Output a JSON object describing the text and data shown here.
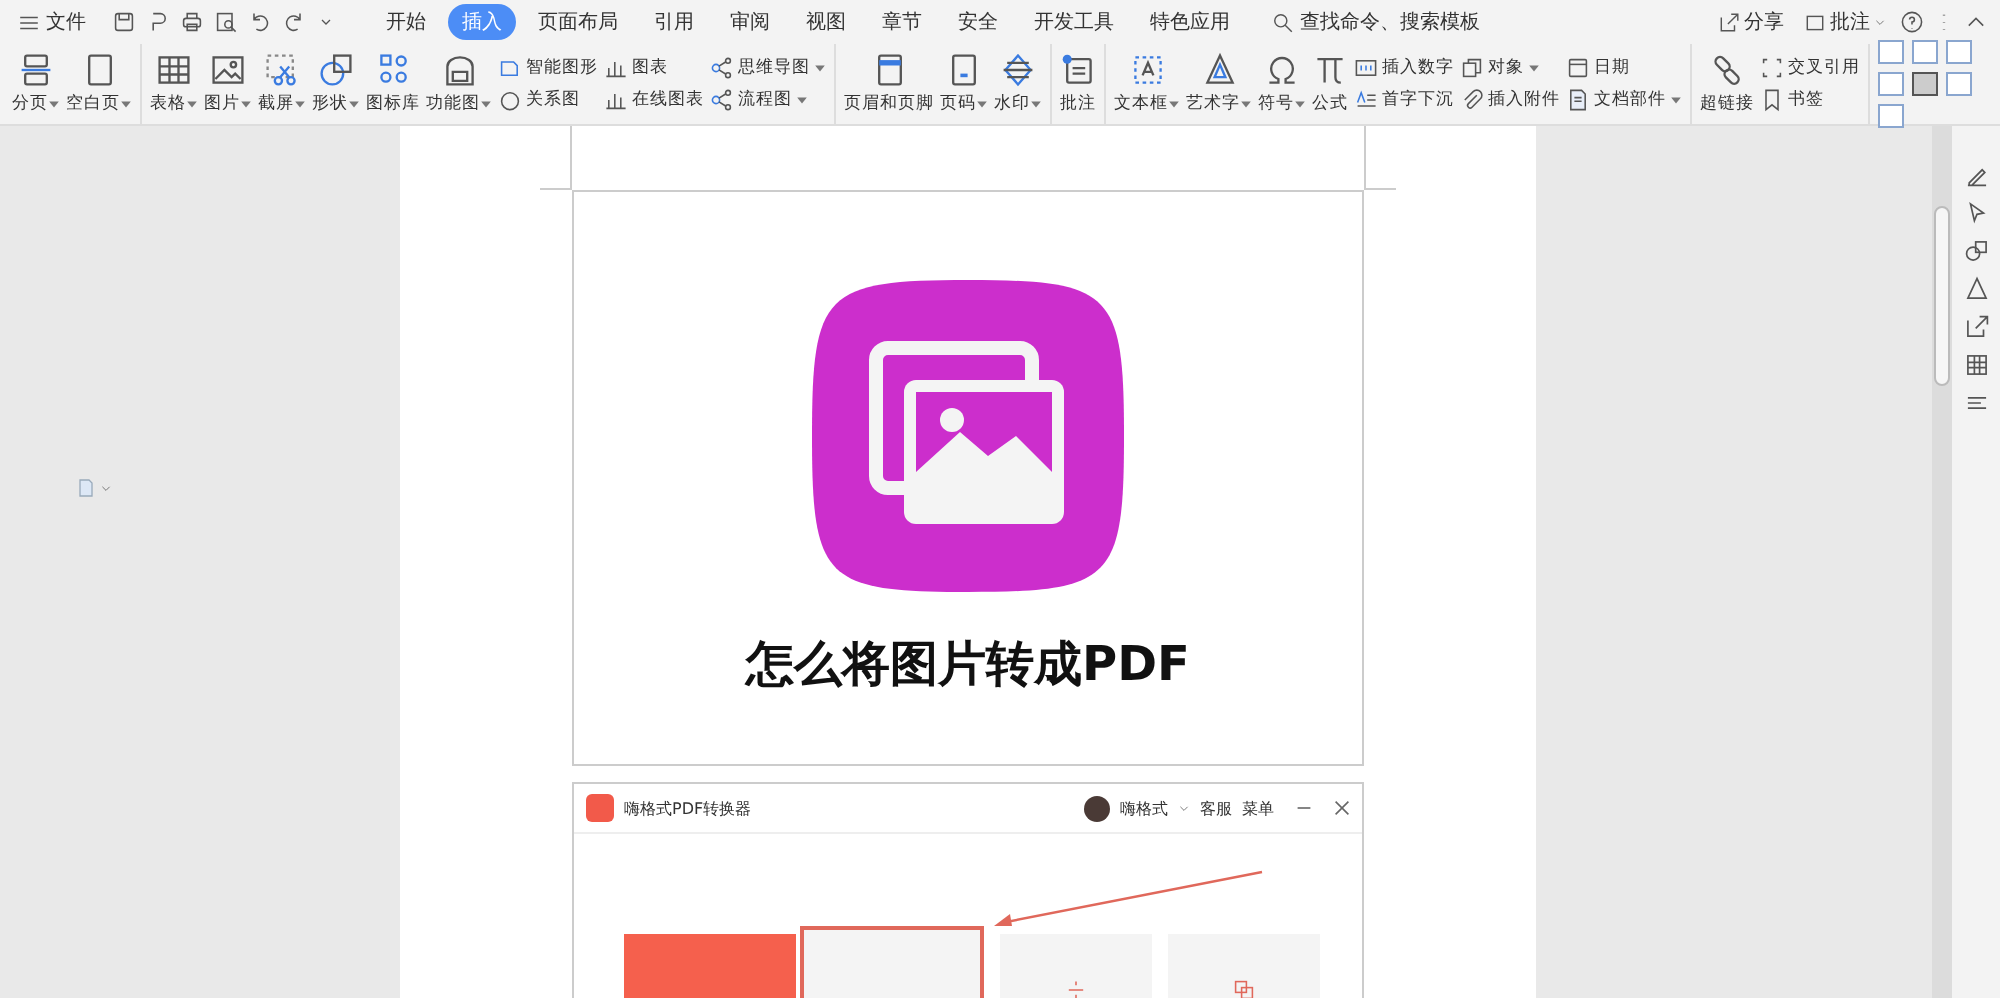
{
  "menubar": {
    "file_label": "文件",
    "tabs": [
      {
        "label": "开始",
        "selected": false
      },
      {
        "label": "插入",
        "selected": true
      },
      {
        "label": "页面布局",
        "selected": false
      },
      {
        "label": "引用",
        "selected": false
      },
      {
        "label": "审阅",
        "selected": false
      },
      {
        "label": "视图",
        "selected": false
      },
      {
        "label": "章节",
        "selected": false
      },
      {
        "label": "安全",
        "selected": false
      },
      {
        "label": "开发工具",
        "selected": false
      },
      {
        "label": "特色应用",
        "selected": false
      }
    ],
    "search": {
      "placeholder": "查找命令、搜索模板"
    },
    "share_label": "分享",
    "comment_label": "批注"
  },
  "ribbon": {
    "groups": [
      {
        "items": [
          {
            "kind": "large",
            "label": "分页",
            "dropdown": true
          },
          {
            "kind": "large",
            "label": "空白页",
            "dropdown": true
          }
        ]
      },
      {
        "items": [
          {
            "kind": "large",
            "label": "表格",
            "dropdown": true
          },
          {
            "kind": "large",
            "label": "图片",
            "dropdown": true
          },
          {
            "kind": "large",
            "label": "截屏",
            "dropdown": true
          },
          {
            "kind": "large",
            "label": "形状",
            "dropdown": true
          },
          {
            "kind": "large",
            "label": "图标库",
            "dropdown": false
          },
          {
            "kind": "large",
            "label": "功能图",
            "dropdown": true
          },
          {
            "kind": "stack",
            "children": [
              {
                "label": "智能图形",
                "dropdown": false
              },
              {
                "label": "关系图",
                "dropdown": false
              }
            ]
          },
          {
            "kind": "stack",
            "children": [
              {
                "label": "图表",
                "dropdown": false
              },
              {
                "label": "在线图表",
                "dropdown": false
              }
            ]
          },
          {
            "kind": "stack",
            "children": [
              {
                "label": "思维导图",
                "dropdown": true
              },
              {
                "label": "流程图",
                "dropdown": true
              }
            ]
          }
        ]
      },
      {
        "items": [
          {
            "kind": "large",
            "label": "页眉和页脚",
            "dropdown": false
          },
          {
            "kind": "large",
            "label": "页码",
            "dropdown": true
          },
          {
            "kind": "large",
            "label": "水印",
            "dropdown": true
          }
        ]
      },
      {
        "items": [
          {
            "kind": "large",
            "label": "批注",
            "dropdown": false
          }
        ]
      },
      {
        "items": [
          {
            "kind": "large",
            "label": "文本框",
            "dropdown": true
          },
          {
            "kind": "large",
            "label": "艺术字",
            "dropdown": true
          },
          {
            "kind": "large",
            "label": "符号",
            "dropdown": true
          },
          {
            "kind": "large",
            "label": "公式",
            "dropdown": false
          },
          {
            "kind": "stack",
            "children": [
              {
                "label": "插入数字",
                "dropdown": false
              },
              {
                "label": "首字下沉",
                "dropdown": false
              }
            ]
          },
          {
            "kind": "stack",
            "children": [
              {
                "label": "对象",
                "dropdown": true
              },
              {
                "label": "插入附件",
                "dropdown": false
              }
            ]
          },
          {
            "kind": "stack",
            "children": [
              {
                "label": "日期",
                "dropdown": false
              },
              {
                "label": "文档部件",
                "dropdown": true
              }
            ]
          }
        ]
      },
      {
        "items": [
          {
            "kind": "large",
            "label": "超链接",
            "dropdown": false
          },
          {
            "kind": "stack",
            "children": [
              {
                "label": "交叉引用",
                "dropdown": false
              },
              {
                "label": "书签",
                "dropdown": false
              }
            ]
          }
        ]
      }
    ]
  },
  "document": {
    "title": "怎么将图片转成PDF",
    "app_window": {
      "title": "嗨格式PDF转换器",
      "user": "嗨格式",
      "links": [
        "客服",
        "菜单"
      ]
    }
  }
}
